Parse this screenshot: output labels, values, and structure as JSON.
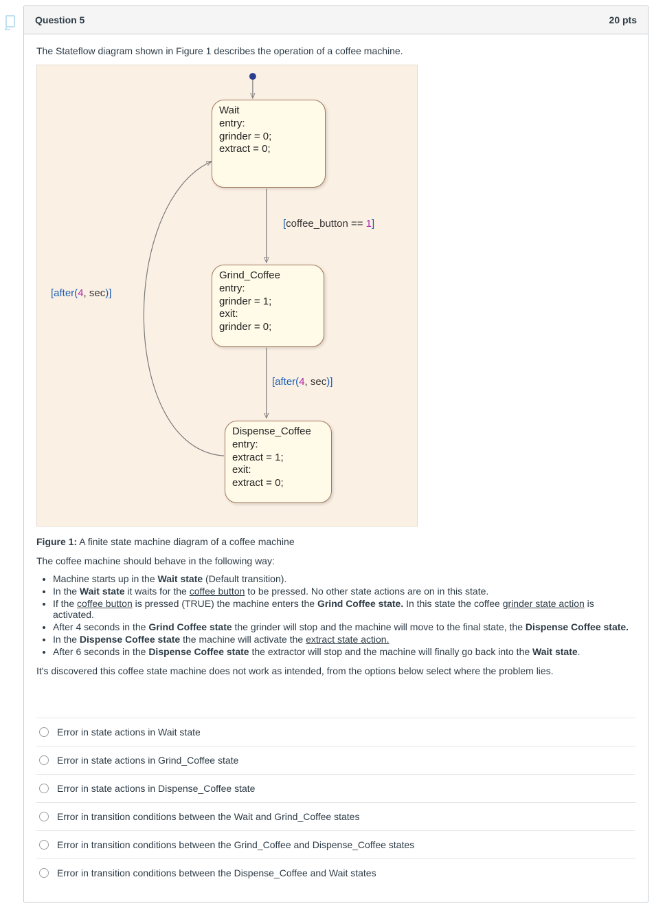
{
  "header": {
    "title": "Question 5",
    "points": "20 pts"
  },
  "intro": "The Stateflow diagram shown in Figure 1 describes the operation of a coffee machine.",
  "diagram": {
    "states": {
      "wait": {
        "name": "Wait",
        "body": "entry:\ngrinder = 0;\nextract = 0;"
      },
      "grind": {
        "name": "Grind_Coffee",
        "body": "entry:\ngrinder = 1;\nexit:\ngrinder = 0;"
      },
      "dispense": {
        "name": "Dispense_Coffee",
        "body": "entry:\nextract = 1;\nexit:\nextract = 0;"
      }
    },
    "transitions": {
      "coffee_btn": {
        "pre": "[",
        "var": "coffee_button",
        "op": " == ",
        "num": "1",
        "post": "]"
      },
      "after4_a": {
        "pre": "[after(",
        "num": "4",
        "mid": ", ",
        "var": "sec",
        "post": ")]"
      },
      "after4_b": {
        "pre": "[after(",
        "num": "4",
        "mid": ", ",
        "var": "sec",
        "post": ")]"
      }
    }
  },
  "caption": {
    "label": "Figure 1:",
    "text": " A finite state machine diagram of a coffee machine"
  },
  "behave_intro": "The coffee machine should behave in the following way:",
  "bullets": [
    {
      "pre": "Machine starts up in the ",
      "b1": "Wait state",
      "post": " (Default transition)."
    },
    {
      "pre": "In the ",
      "b1": "Wait state",
      "mid": " it waits for the ",
      "u1": "coffee button",
      "post": " to be pressed. No other state actions are on in this state."
    },
    {
      "pre": "If the ",
      "u1": "coffee button",
      "mid": " is pressed (TRUE) the machine enters the ",
      "b1": "Grind Coffee state.",
      "mid2": " In this state the coffee ",
      "u2": "grinder state action",
      "post": " is activated."
    },
    {
      "pre": "After 4 seconds in the ",
      "b1": "Grind Coffee state",
      "mid": " the grinder will stop and the machine will move to the final state, the ",
      "b2": "Dispense Coffee state.",
      "post": ""
    },
    {
      "pre": "In the ",
      "b1": "Dispense Coffee state",
      "mid": " the machine will activate the ",
      "u1": "extract state action.",
      "post": ""
    },
    {
      "pre": "After 6 seconds in the ",
      "b1": "Dispense Coffee state",
      "mid": " the extractor will stop and the machine will finally go back into the ",
      "b2": "Wait state",
      "post": "."
    }
  ],
  "prompt": "It's discovered this coffee state machine does not work as intended, from the options below select where the problem lies.",
  "options": [
    "Error in state actions in Wait state",
    "Error in state actions in Grind_Coffee state",
    "Error in state actions in Dispense_Coffee state",
    "Error in transition conditions between the Wait and Grind_Coffee states",
    "Error in transition conditions between the Grind_Coffee and Dispense_Coffee states",
    "Error in transition conditions between the Dispense_Coffee and Wait states"
  ]
}
